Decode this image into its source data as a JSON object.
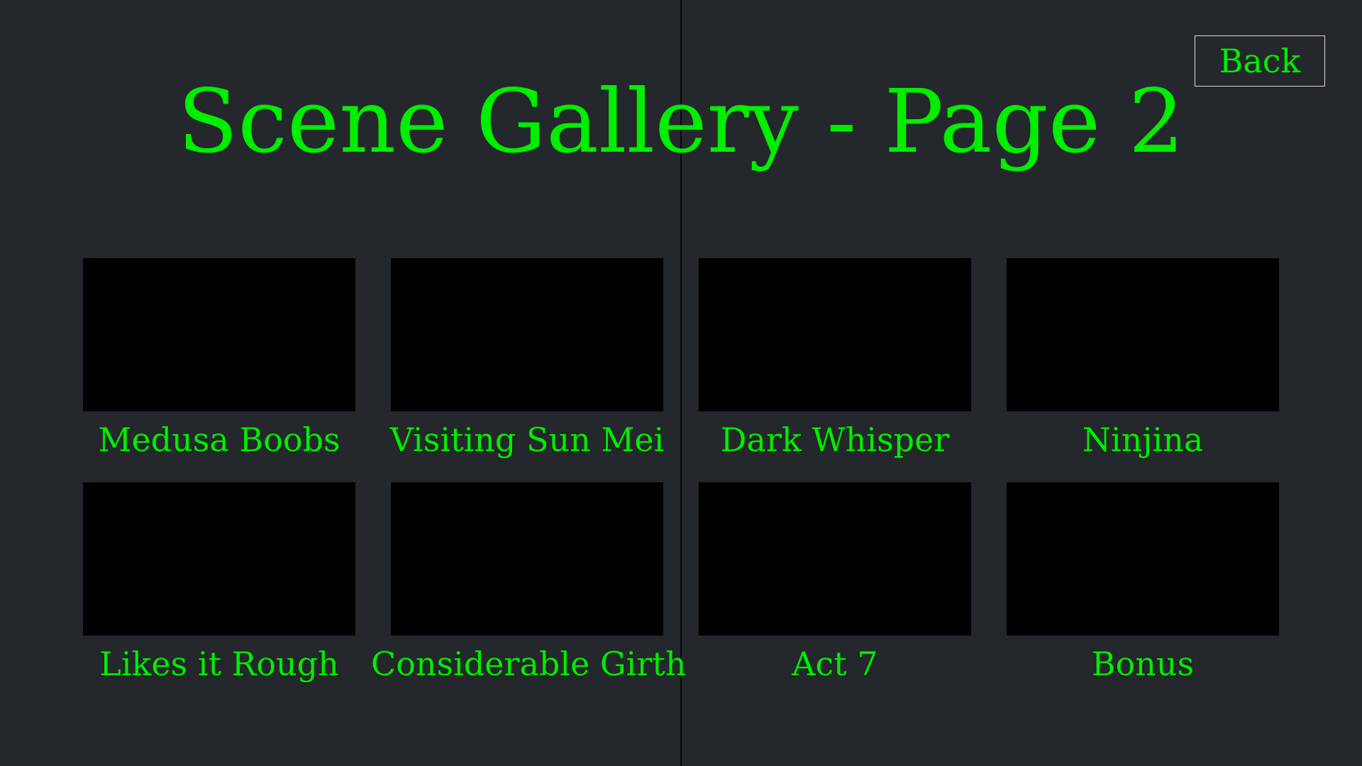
{
  "gallery": {
    "title": "Scene Gallery - Page 2",
    "back_label": "Back",
    "scenes": [
      {
        "label": "Medusa Boobs"
      },
      {
        "label": "Visiting Sun Mei"
      },
      {
        "label": "Dark Whisper"
      },
      {
        "label": "Ninjina"
      },
      {
        "label": "Likes it Rough"
      },
      {
        "label": "Considerable Girth"
      },
      {
        "label": "Act 7"
      },
      {
        "label": "Bonus"
      }
    ]
  },
  "colors": {
    "background": "#24272b",
    "text": "#00ee00",
    "thumbnail": "#000000",
    "divider": "#0a0a0a"
  }
}
